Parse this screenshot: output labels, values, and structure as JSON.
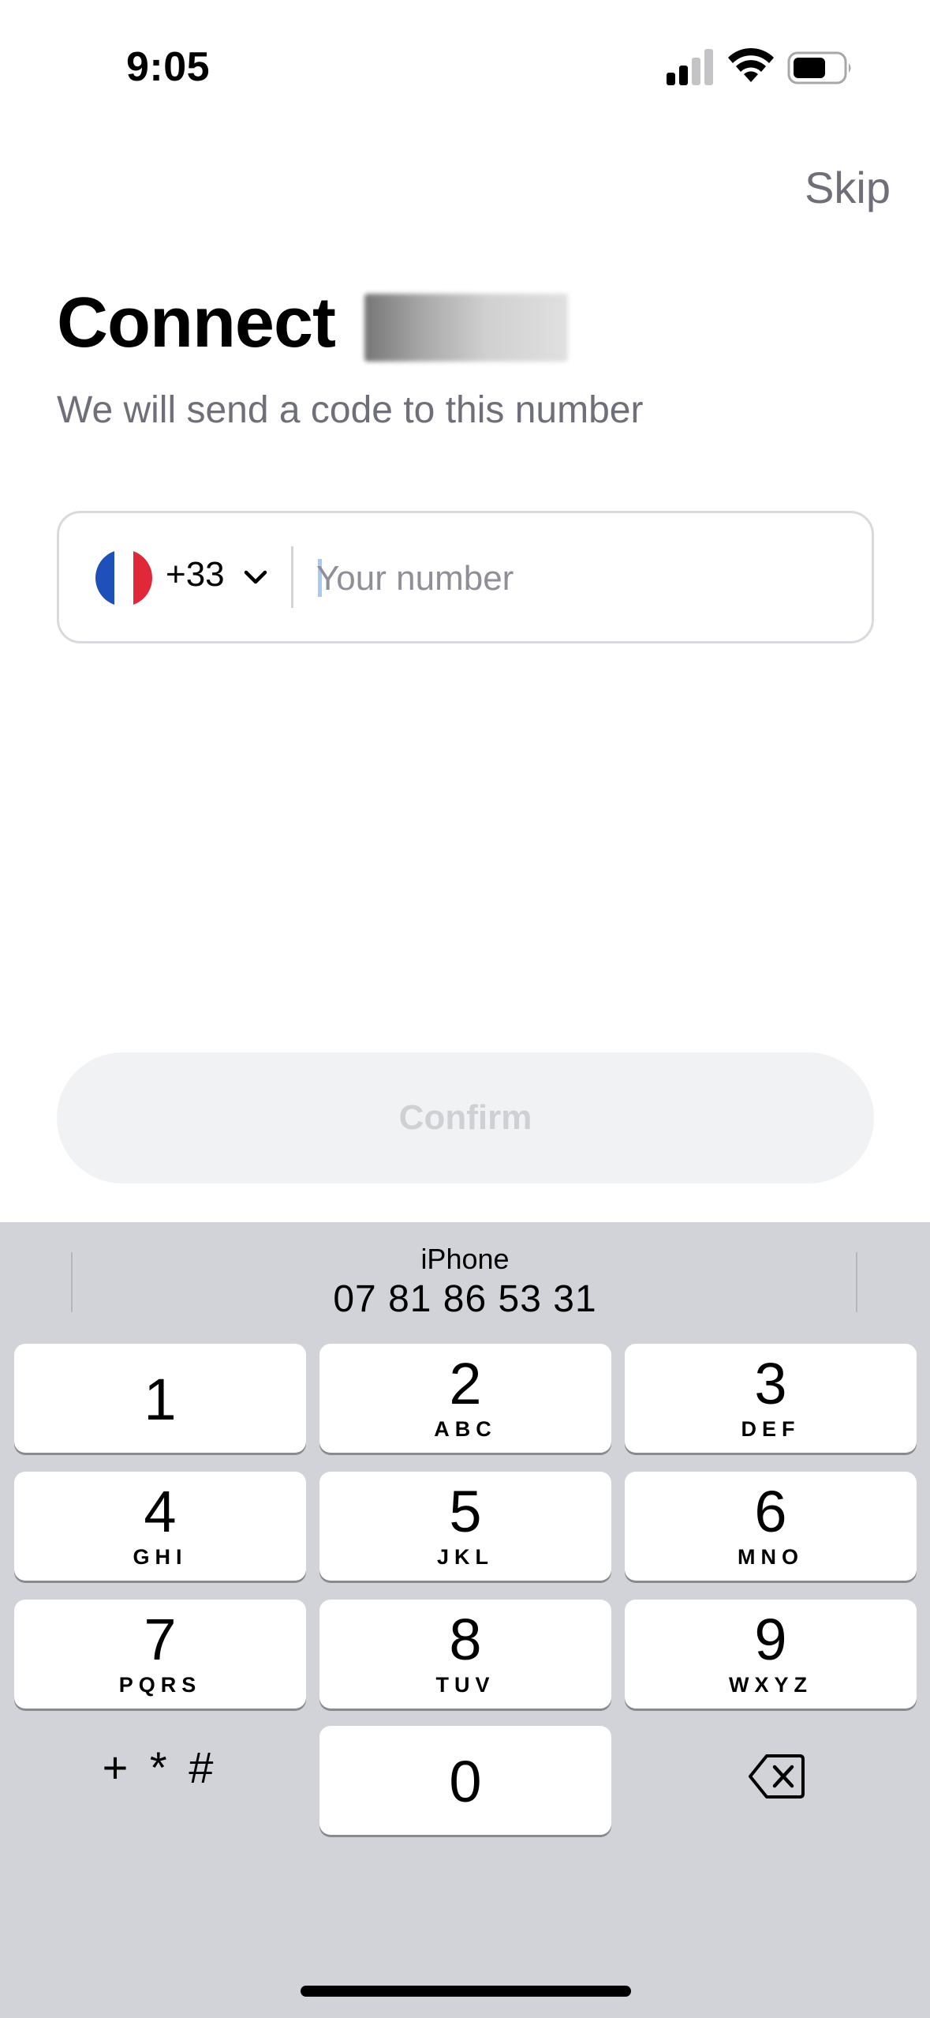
{
  "status_bar": {
    "time": "9:05",
    "signal_icon": "cellular-signal-icon",
    "wifi_icon": "wifi-icon",
    "battery_icon": "battery-icon"
  },
  "header": {
    "skip_label": "Skip"
  },
  "main": {
    "title": "Connect",
    "subtitle": "We will send a code to this number"
  },
  "phone_field": {
    "country_flag_icon": "france-flag-icon",
    "dial_code": "+33",
    "number_value": "",
    "placeholder": "Your number"
  },
  "confirm_label": "Confirm",
  "keyboard": {
    "suggestion_label": "iPhone",
    "suggestion_value": "07 81 86 53 31",
    "keys": [
      {
        "digit": "1",
        "letters": ""
      },
      {
        "digit": "2",
        "letters": "ABC"
      },
      {
        "digit": "3",
        "letters": "DEF"
      },
      {
        "digit": "4",
        "letters": "GHI"
      },
      {
        "digit": "5",
        "letters": "JKL"
      },
      {
        "digit": "6",
        "letters": "MNO"
      },
      {
        "digit": "7",
        "letters": "PQRS"
      },
      {
        "digit": "8",
        "letters": "TUV"
      },
      {
        "digit": "9",
        "letters": "WXYZ"
      },
      {
        "digit": "0",
        "letters": ""
      }
    ],
    "symbols_label": "+ * #"
  },
  "colors": {
    "flag_blue": "#1f4fb8",
    "flag_white": "#ffffff",
    "flag_red": "#e0283a",
    "muted_text": "#6e6f78",
    "keyboard_bg": "#d1d3d9"
  }
}
